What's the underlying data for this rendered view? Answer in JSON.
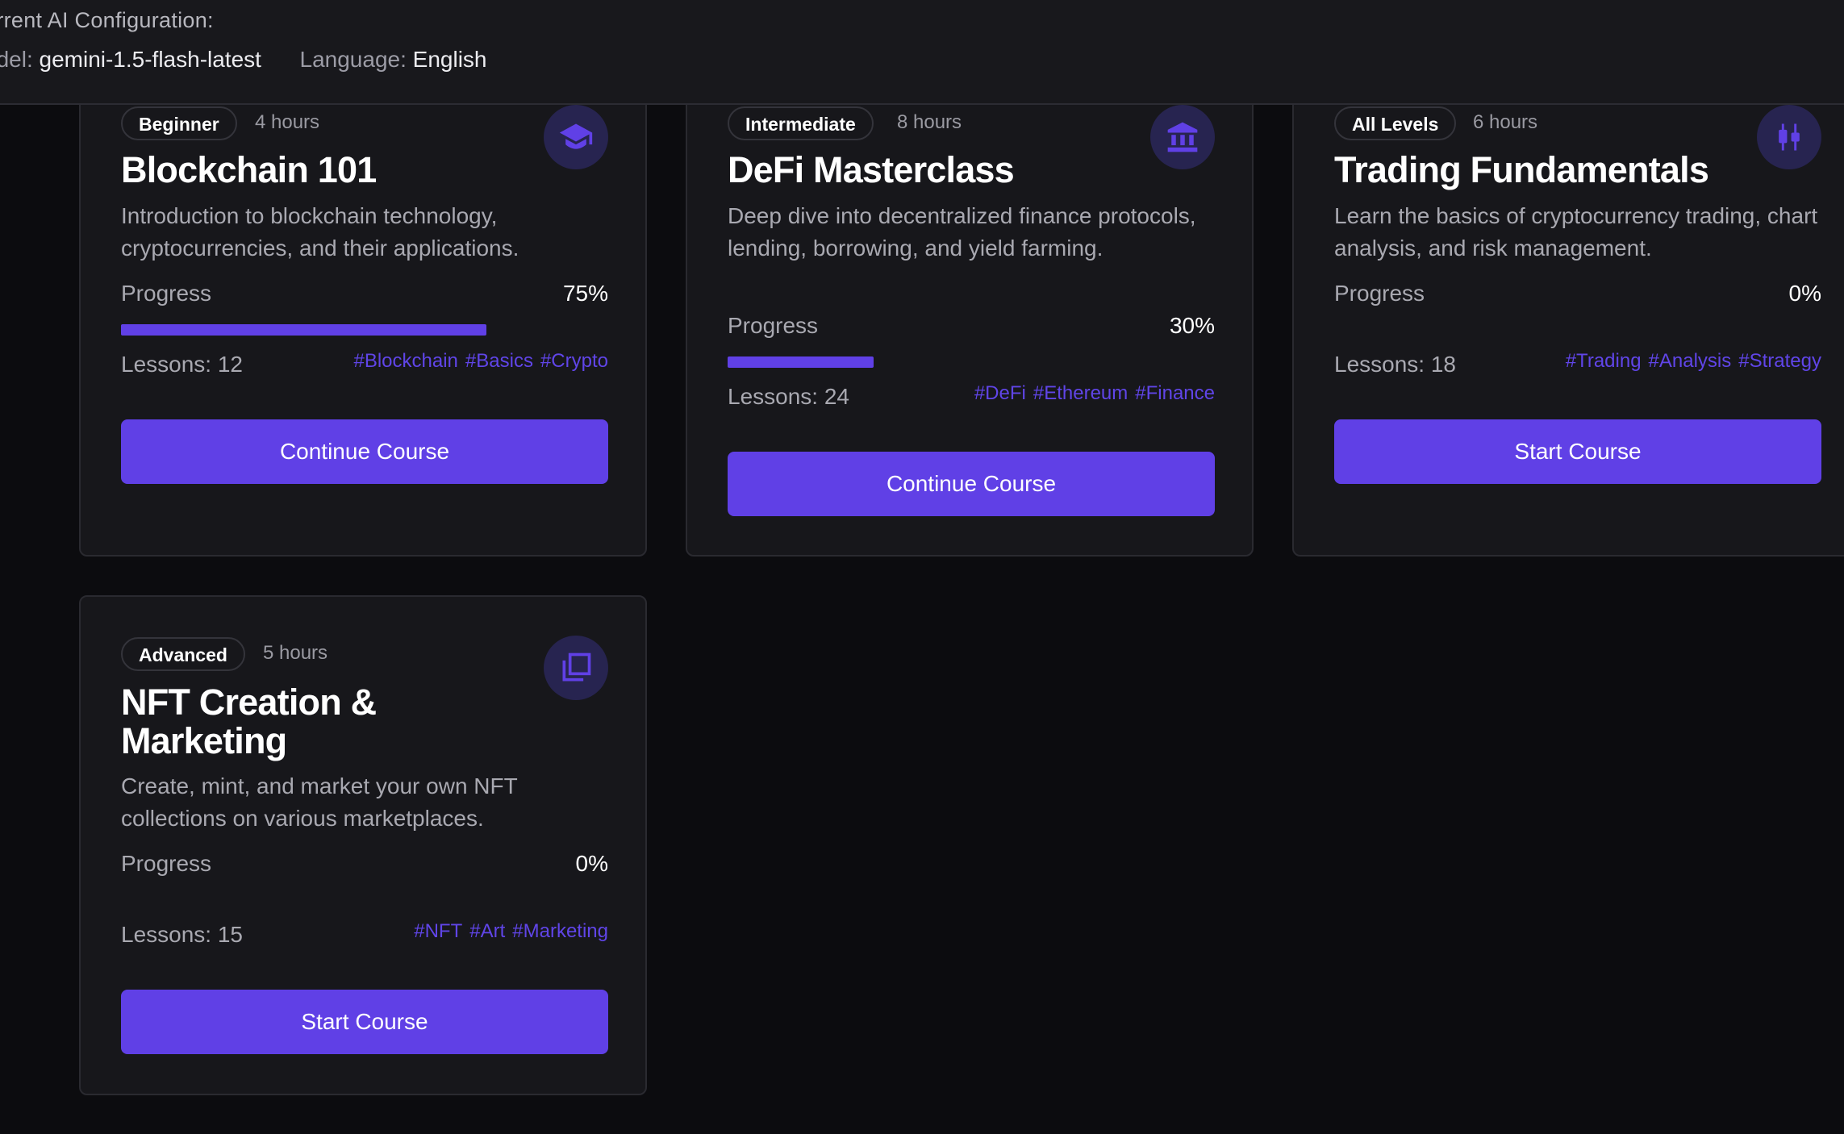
{
  "ai_config": {
    "title": "urrent AI Configuration:",
    "model_label": "odel:",
    "model_value": "gemini-1.5-flash-latest",
    "language_label": "Language:",
    "language_value": "English"
  },
  "progress_label": "Progress",
  "accent_color": "#6040e6",
  "courses": [
    {
      "level": "Beginner",
      "duration": "4 hours",
      "icon": "graduation-cap-icon",
      "title": "Blockchain 101",
      "description": "Introduction to blockchain technology, cryptocurrencies, and their applications.",
      "progress_text": "75%",
      "progress_value": 0.75,
      "lessons": "Lessons: 12",
      "tags": [
        "#Blockchain",
        "#Basics",
        "#Crypto"
      ],
      "button": "Continue Course"
    },
    {
      "level": "Intermediate",
      "duration": "8 hours",
      "icon": "bank-icon",
      "title": "DeFi Masterclass",
      "description": "Deep dive into decentralized finance protocols, lending, borrowing, and yield farming.",
      "progress_text": "30%",
      "progress_value": 0.3,
      "lessons": "Lessons: 24",
      "tags": [
        "#DeFi",
        "#Ethereum",
        "#Finance"
      ],
      "button": "Continue Course"
    },
    {
      "level": "All Levels",
      "duration": "6 hours",
      "icon": "candlestick-chart-icon",
      "title": "Trading Fundamentals",
      "description": "Learn the basics of cryptocurrency trading, chart analysis, and risk management.",
      "progress_text": "0%",
      "progress_value": 0,
      "lessons": "Lessons: 18",
      "tags": [
        "#Trading",
        "#Analysis",
        "#Strategy"
      ],
      "button": "Start Course"
    },
    {
      "level": "Advanced",
      "duration": "5 hours",
      "icon": "layers-square-icon",
      "title": "NFT Creation & Marketing",
      "description": "Create, mint, and market your own NFT collections on various marketplaces.",
      "progress_text": "0%",
      "progress_value": 0,
      "lessons": "Lessons: 15",
      "tags": [
        "#NFT",
        "#Art",
        "#Marketing"
      ],
      "button": "Start Course"
    }
  ]
}
